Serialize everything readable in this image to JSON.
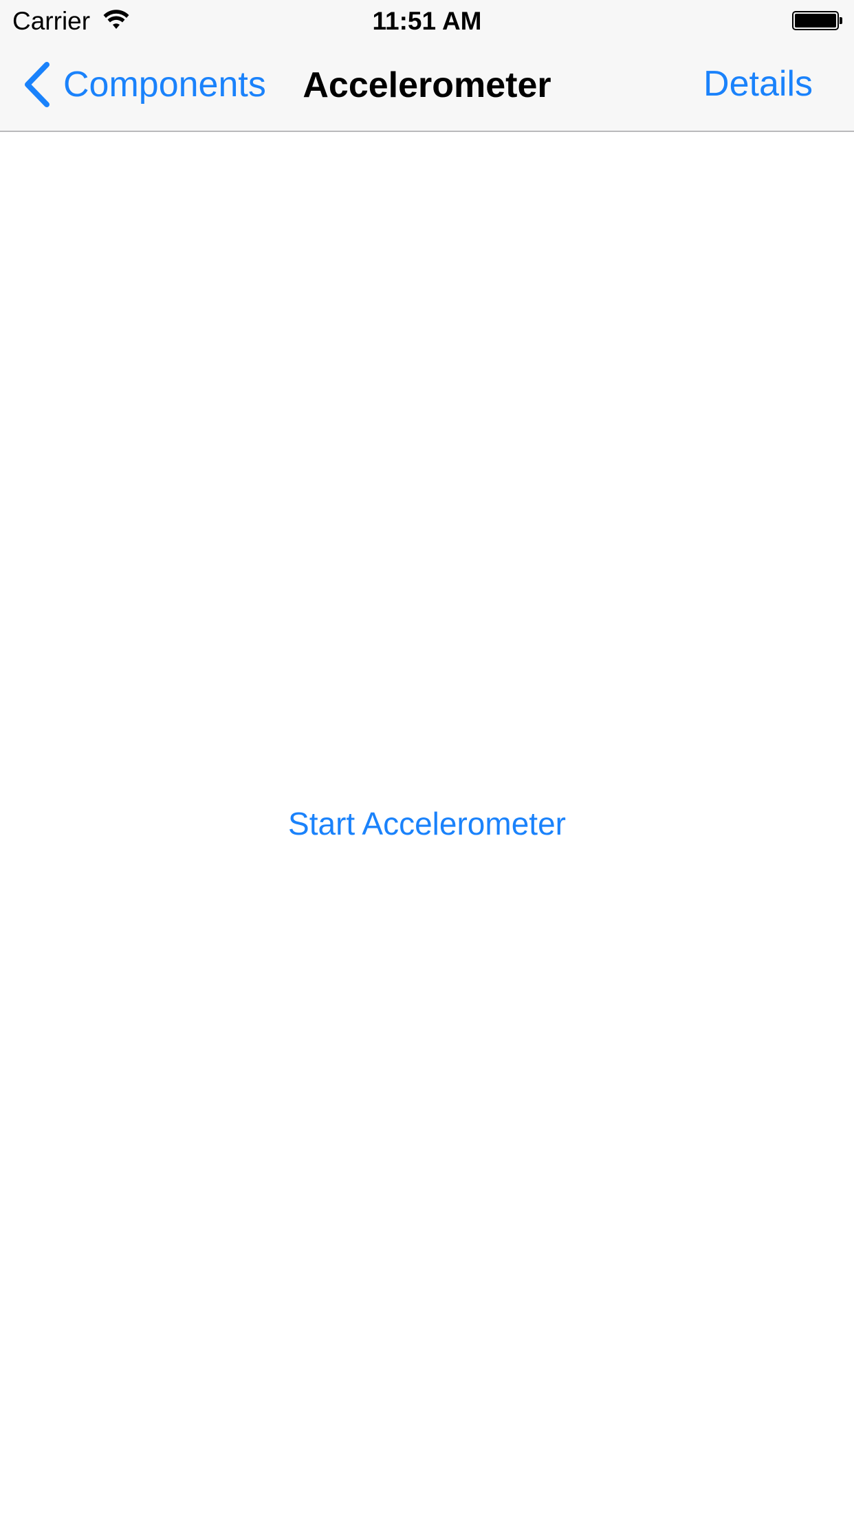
{
  "status_bar": {
    "carrier": "Carrier",
    "time": "11:51 AM",
    "wifi_icon": "wifi-icon",
    "battery_icon": "battery-full-icon",
    "battery_level": 1.0
  },
  "nav_bar": {
    "back_label": "Components",
    "back_icon": "chevron-left-icon",
    "title": "Accelerometer",
    "details_label": "Details"
  },
  "main": {
    "start_button_label": "Start Accelerometer"
  },
  "colors": {
    "tint": "#1a82fb",
    "nav_background": "#f7f7f7",
    "background": "#ffffff",
    "text": "#000000"
  }
}
